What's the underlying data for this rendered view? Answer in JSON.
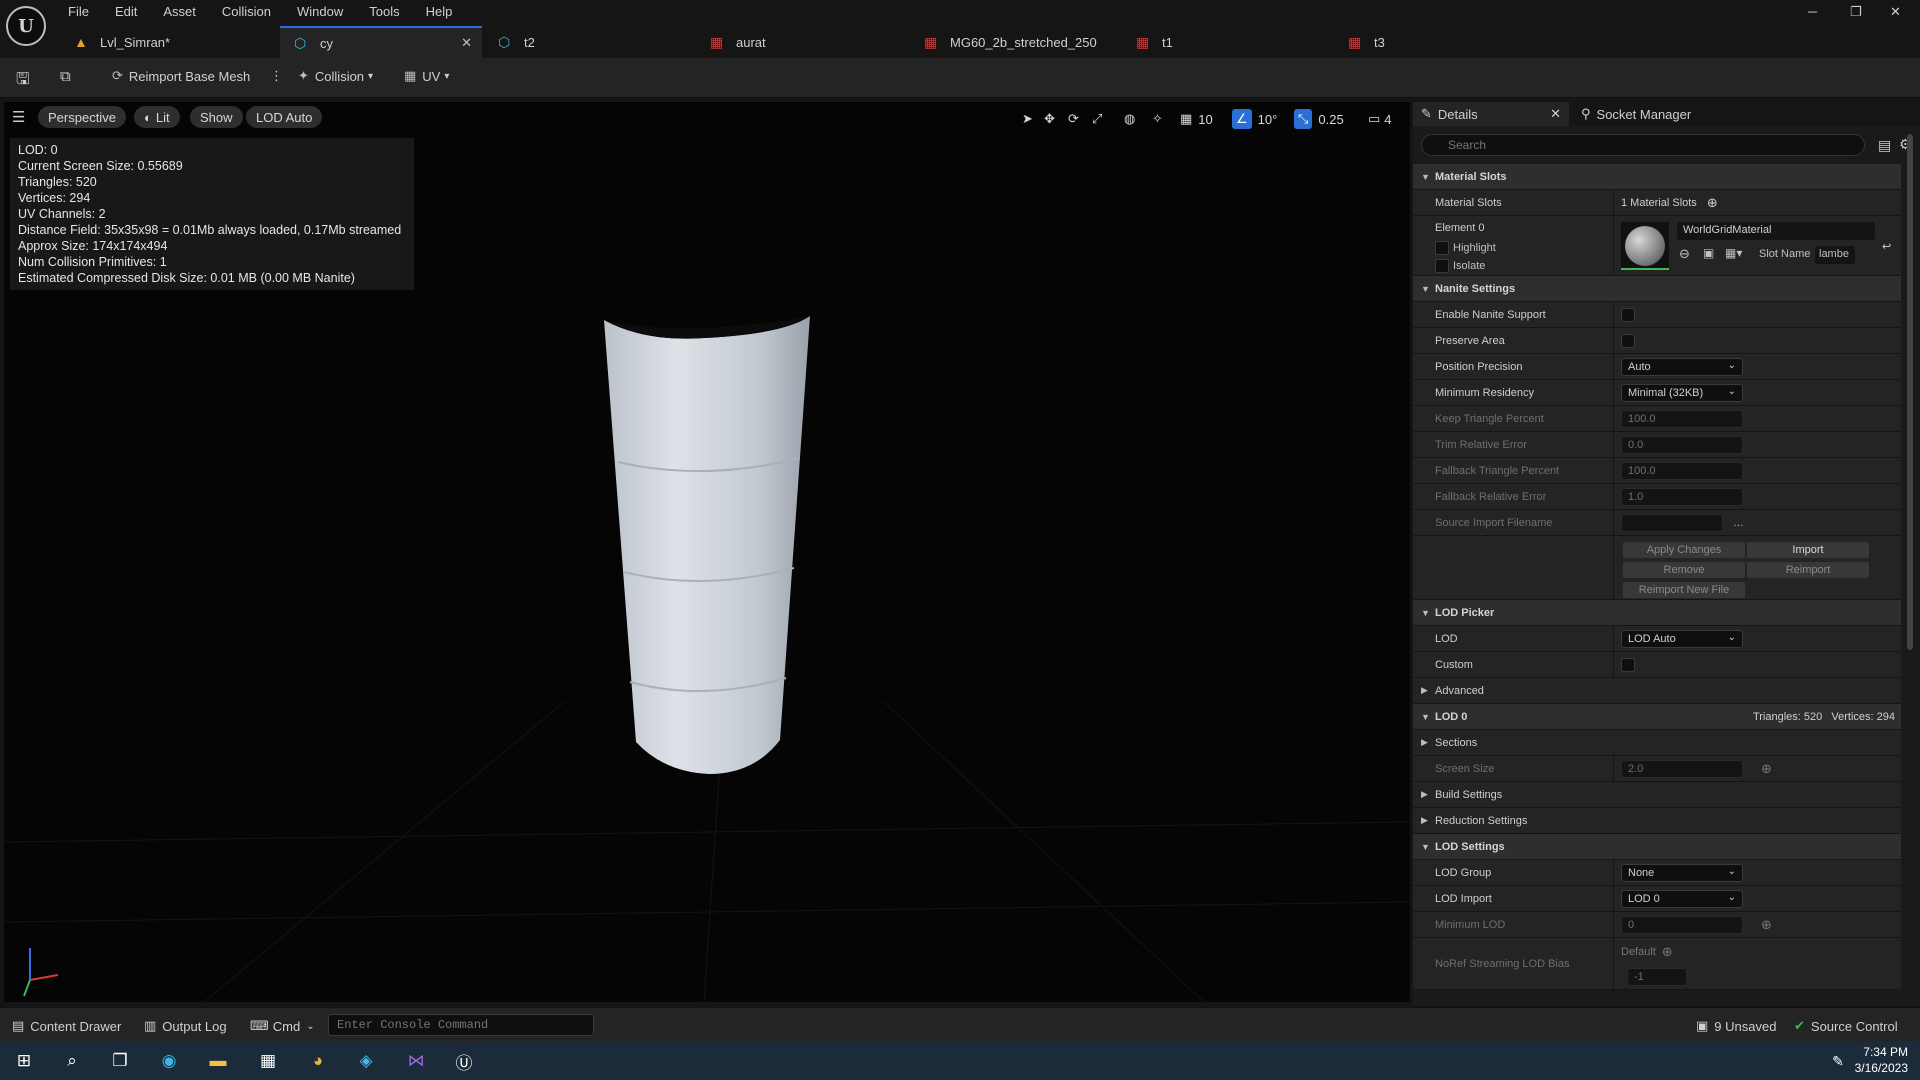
{
  "menu": [
    "File",
    "Edit",
    "Asset",
    "Collision",
    "Window",
    "Tools",
    "Help"
  ],
  "window_controls": {
    "minimize": "─",
    "restore": "❐",
    "close": "✕"
  },
  "tabs": [
    {
      "label": "Lvl_Simran*",
      "icon": "level-icon"
    },
    {
      "label": "cy",
      "icon": "static-mesh-icon"
    },
    {
      "label": "t2",
      "icon": "static-mesh-icon"
    },
    {
      "label": "aurat",
      "icon": "material-icon"
    },
    {
      "label": "MG60_2b_stretched_250",
      "icon": "material-icon"
    },
    {
      "label": "t1",
      "icon": "material-icon"
    },
    {
      "label": "t3",
      "icon": "material-icon"
    }
  ],
  "toolbar": {
    "reimport": "Reimport Base Mesh",
    "collision": "Collision",
    "uv": "UV"
  },
  "viewport": {
    "perspective": "Perspective",
    "lit": "Lit",
    "show": "Show",
    "lod": "LOD Auto",
    "stats": [
      "LOD:  0",
      "Current Screen Size:  0.55689",
      "Triangles:  520",
      "Vertices:  294",
      "UV Channels:  2",
      "Distance Field:  35x35x98 = 0.01Mb always loaded, 0.17Mb streamed",
      "Approx Size: 174x174x494",
      "Num Collision Primitives:  1",
      "Estimated Compressed Disk Size: 0.01 MB (0.00 MB Nanite)"
    ],
    "grid_snap": "10",
    "rot_snap": "10°",
    "scale_snap": "0.25",
    "cam_speed": "4"
  },
  "details": {
    "tab_details": "Details",
    "tab_socket": "Socket Manager",
    "search_placeholder": "Search",
    "material_slots_header": "Material Slots",
    "material_slots_label": "Material Slots",
    "material_slots_value": "1 Material Slots",
    "element0": "Element 0",
    "highlight": "Highlight",
    "isolate": "Isolate",
    "material_name": "WorldGridMaterial",
    "slot_name_label": "Slot Name",
    "slot_name_value": "lambe",
    "nanite_header": "Nanite Settings",
    "enable_nanite": "Enable Nanite Support",
    "preserve_area": "Preserve Area",
    "position_precision": "Position Precision",
    "position_precision_value": "Auto",
    "min_residency": "Minimum Residency",
    "min_residency_value": "Minimal (32KB)",
    "keep_tri": "Keep Triangle Percent",
    "keep_tri_value": "100.0",
    "trim_err": "Trim Relative Error",
    "trim_err_value": "0.0",
    "fallback_tri": "Fallback Triangle Percent",
    "fallback_tri_value": "100.0",
    "fallback_err": "Fallback Relative Error",
    "fallback_err_value": "1.0",
    "source_import": "Source Import Filename",
    "apply_changes": "Apply Changes",
    "import": "Import",
    "remove": "Remove",
    "reimport": "Reimport",
    "reimport_new": "Reimport New File",
    "lod_picker_header": "LOD Picker",
    "lod_label": "LOD",
    "lod_value": "LOD Auto",
    "custom": "Custom",
    "advanced": "Advanced",
    "lod0_header": "LOD 0",
    "lod0_stats": "Triangles: 520   Vertices: 294",
    "sections": "Sections",
    "screen_size": "Screen Size",
    "screen_size_value": "2.0",
    "build_settings": "Build Settings",
    "reduction_settings": "Reduction Settings",
    "lod_settings_header": "LOD Settings",
    "lod_group": "LOD Group",
    "lod_group_value": "None",
    "lod_import": "LOD Import",
    "lod_import_value": "LOD 0",
    "min_lod": "Minimum LOD",
    "min_lod_value": "0",
    "noref_bias": "NoRef Streaming LOD Bias",
    "noref_default": "Default",
    "noref_value": "-1"
  },
  "bottom": {
    "content_drawer": "Content Drawer",
    "output_log": "Output Log",
    "cmd": "Cmd",
    "console_placeholder": "Enter Console Command",
    "unsaved": "9 Unsaved",
    "source_control": "Source Control"
  },
  "clock": {
    "time": "7:34 PM",
    "date": "3/16/2023"
  }
}
